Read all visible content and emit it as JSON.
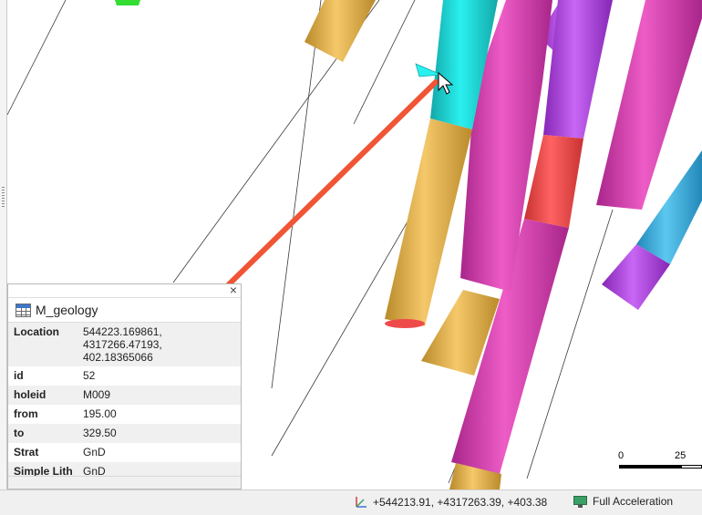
{
  "viewer": {
    "scale_bar": {
      "label_start": "0",
      "label_end": "25"
    }
  },
  "properties_panel": {
    "title": "M_geology",
    "close_glyph": "×",
    "icon": "table-icon",
    "rows": [
      {
        "key": "Location",
        "value": "544223.169861,\n4317266.47193,\n402.18365066"
      },
      {
        "key": "id",
        "value": "52"
      },
      {
        "key": "holeid",
        "value": "M009"
      },
      {
        "key": "from",
        "value": "195.00"
      },
      {
        "key": "to",
        "value": "329.50"
      },
      {
        "key": "Strat",
        "value": "GnD"
      },
      {
        "key": "Simple Lith",
        "value": "GnD"
      }
    ]
  },
  "status_bar": {
    "coordinates": "+544213.91, +4317263.39, +403.38",
    "coord_icon": "axes-icon",
    "acceleration": "Full Acceleration",
    "acceleration_icon": "monitor-icon"
  },
  "colors": {
    "gold": "#e8b04a",
    "magenta": "#d63aad",
    "violet": "#b03ee0",
    "cyan": "#1fd6d6",
    "sky": "#3cb4e0",
    "red": "#ef4a4a",
    "green": "#33dd33",
    "arrow": "#f05535"
  }
}
